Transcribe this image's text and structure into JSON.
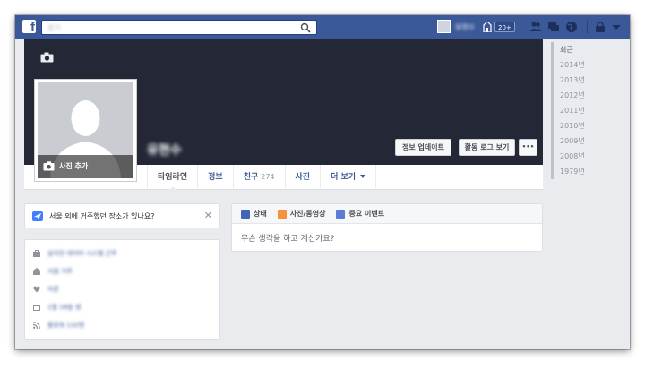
{
  "topbar": {
    "logo": "f",
    "search_placeholder": "찾기",
    "user_name": "유현수",
    "home_badge": "20+"
  },
  "cover": {
    "add_photo_label": "사진 추가",
    "profile_name": "유현수",
    "update_info_button": "정보 업데이트",
    "activity_log_button": "활동 로그 보기",
    "more_button": "•••"
  },
  "tabs": {
    "timeline": "타임라인",
    "about": "정보",
    "friends": "친구",
    "friends_count": "274",
    "photos": "사진",
    "more": "더 보기"
  },
  "years": [
    "최근",
    "2014년",
    "2013년",
    "2012년",
    "2011년",
    "2010년",
    "2009년",
    "2008년",
    "1979년"
  ],
  "prompt": {
    "text": "서울 외에 거주했던 장소가 있나요?",
    "close": "✕"
  },
  "intro": {
    "items": [
      {
        "icon": "briefcase-icon",
        "text": "삼지안 데이터 시스템 근무"
      },
      {
        "icon": "school-icon",
        "text": "서울 거주"
      },
      {
        "icon": "heart-icon",
        "text": "미혼"
      },
      {
        "icon": "calendar-icon",
        "text": "1월 16일 생"
      },
      {
        "icon": "rss-icon",
        "text": "팔로워 132명"
      }
    ]
  },
  "composer": {
    "status_tab": "상태",
    "photo_tab": "사진/동영상",
    "event_tab": "중요 이벤트",
    "placeholder": "무슨 생각을 하고 계신가요?"
  },
  "colors": {
    "brand_blue": "#3b5998",
    "cover_dark": "#232736",
    "link_blue": "#365899",
    "page_bg": "#e9ebee"
  }
}
